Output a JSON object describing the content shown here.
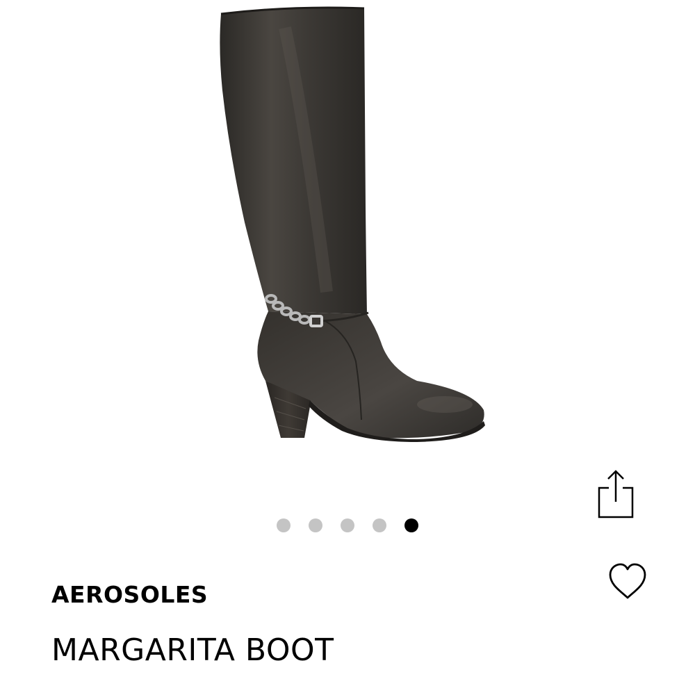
{
  "product": {
    "brand": "AEROSOLES",
    "name": "MARGARITA BOOT",
    "image_subject": "boot-icon"
  },
  "carousel": {
    "total": 5,
    "active_index": 4
  },
  "actions": {
    "share_icon": "share-icon",
    "favorite_icon": "heart-icon"
  },
  "colors": {
    "dot_inactive": "#c4c4c4",
    "dot_active": "#000000",
    "text": "#000000",
    "boot_leather": "#3a3733"
  }
}
